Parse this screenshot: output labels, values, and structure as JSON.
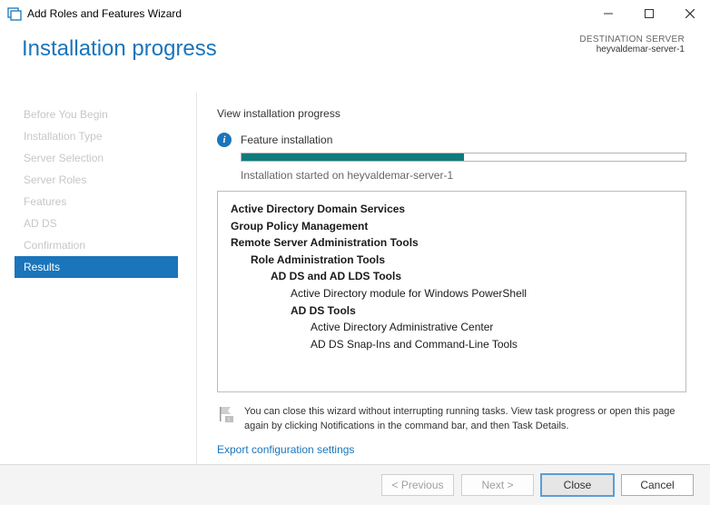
{
  "window": {
    "title": "Add Roles and Features Wizard"
  },
  "header": {
    "title": "Installation progress",
    "dest_label": "DESTINATION SERVER",
    "dest_server": "heyvaldemar-server-1"
  },
  "nav": {
    "items": [
      "Before You Begin",
      "Installation Type",
      "Server Selection",
      "Server Roles",
      "Features",
      "AD DS",
      "Confirmation",
      "Results"
    ],
    "active_index": 7
  },
  "content": {
    "section_title": "View installation progress",
    "feature_label": "Feature installation",
    "progress_percent": 50,
    "status_line": "Installation started on heyvaldemar-server-1",
    "details": [
      {
        "text": "Active Directory Domain Services",
        "indent": 0,
        "bold": true
      },
      {
        "text": "Group Policy Management",
        "indent": 0,
        "bold": true
      },
      {
        "text": "Remote Server Administration Tools",
        "indent": 0,
        "bold": true
      },
      {
        "text": "Role Administration Tools",
        "indent": 1,
        "bold": true
      },
      {
        "text": "AD DS and AD LDS Tools",
        "indent": 2,
        "bold": true
      },
      {
        "text": "Active Directory module for Windows PowerShell",
        "indent": 3,
        "bold": false
      },
      {
        "text": "AD DS Tools",
        "indent": 3,
        "bold": true
      },
      {
        "text": "Active Directory Administrative Center",
        "indent": 4,
        "bold": false
      },
      {
        "text": "AD DS Snap-Ins and Command-Line Tools",
        "indent": 4,
        "bold": false
      }
    ],
    "tip": "You can close this wizard without interrupting running tasks. View task progress or open this page again by clicking Notifications in the command bar, and then Task Details.",
    "export_link": "Export configuration settings"
  },
  "footer": {
    "previous": "< Previous",
    "next": "Next >",
    "install": "Close",
    "cancel": "Cancel"
  }
}
